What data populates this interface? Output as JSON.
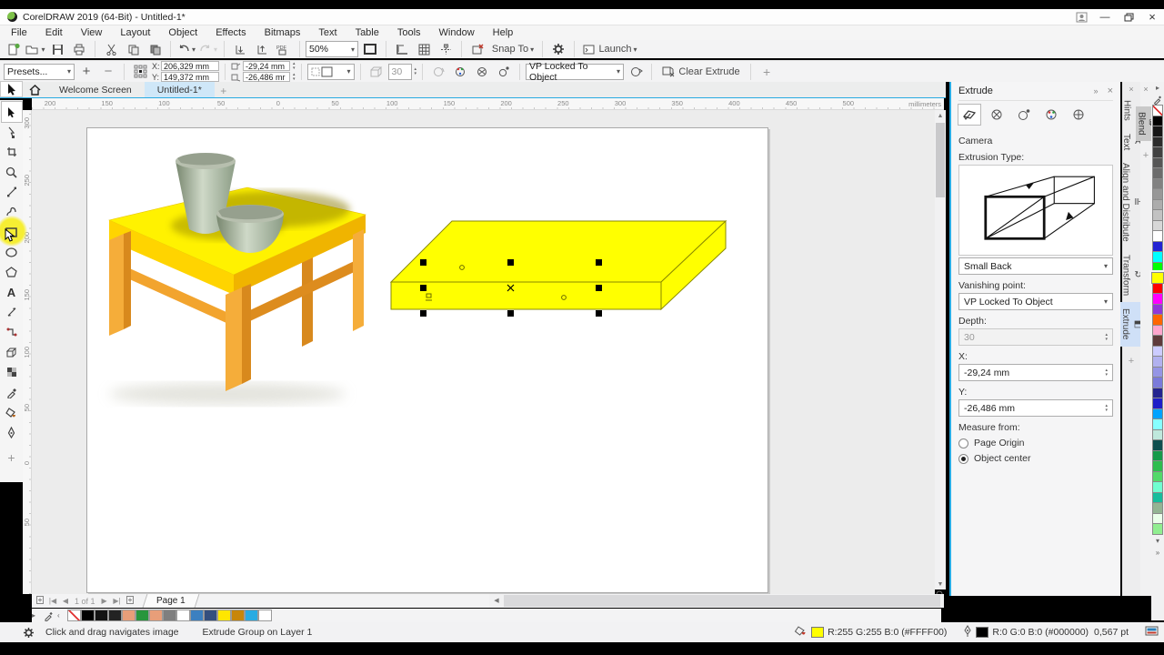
{
  "title_bar": {
    "title": "CorelDRAW 2019 (64-Bit) - Untitled-1*"
  },
  "menu_bar": {
    "items": [
      "File",
      "Edit",
      "View",
      "Layout",
      "Object",
      "Effects",
      "Bitmaps",
      "Text",
      "Table",
      "Tools",
      "Window",
      "Help"
    ]
  },
  "standard_toolbar": {
    "zoom_level": "50%",
    "snap_to_label": "Snap To",
    "launch_label": "Launch"
  },
  "property_bar": {
    "presets_label": "Presets...",
    "x_label": "X:",
    "x_value": "206,329 mm",
    "y_label": "Y:",
    "y_value": "149,372 mm",
    "vp_x_value": "-29,24 mm",
    "vp_y_value": "-26,486 mr",
    "depth_value": "30",
    "vp_mode": "VP Locked To Object",
    "clear_extrude_label": "Clear Extrude"
  },
  "document_tabs": {
    "tabs": [
      {
        "label": "Welcome Screen"
      },
      {
        "label": "Untitled-1*"
      }
    ],
    "active": "Untitled-1*"
  },
  "ruler": {
    "h_ticks": [
      "200",
      "150",
      "100",
      "50",
      "0",
      "50",
      "100",
      "150",
      "200",
      "250",
      "300",
      "350",
      "400",
      "450",
      "500"
    ],
    "v_ticks": [
      "300",
      "250",
      "200",
      "150",
      "100",
      "50",
      "0",
      "50"
    ],
    "units": "millimeters"
  },
  "toolbox": {
    "tools": [
      "pick",
      "shape",
      "crop",
      "zoom",
      "freehand",
      "artistic-media",
      "rectangle",
      "ellipse",
      "polygon",
      "text",
      "parallel-dimension",
      "connector",
      "extrude",
      "transparency",
      "color-eyedropper",
      "interactive-fill",
      "smart-fill"
    ]
  },
  "docker": {
    "title": "Extrude",
    "camera_label": "Camera",
    "extrusion_type_label": "Extrusion Type:",
    "extrusion_preset": "Small Back",
    "vanishing_point_label": "Vanishing point:",
    "vanishing_point_value": "VP Locked To Object",
    "depth_label": "Depth:",
    "depth_value": "30",
    "x_label": "X:",
    "x_value": "-29,24 mm",
    "y_label": "Y:",
    "y_value": "-26,486 mm",
    "measure_from_label": "Measure from:",
    "radio_page_origin": "Page Origin",
    "radio_object_center": "Object center",
    "selected_radio": "Object center"
  },
  "docker_tabs": {
    "items": [
      "Hints",
      "Text",
      "Align and Distribute",
      "Transform",
      "Extrude"
    ],
    "active": "Extrude",
    "blend_label": "Blend"
  },
  "page_controls": {
    "count_text": "1 of 1",
    "page_tab": "Page 1"
  },
  "status_bar": {
    "hint": "Click and drag navigates image",
    "selection_info": "Extrude Group on Layer 1",
    "fill_color_hex": "#FFFF00",
    "fill_info": "R:255 G:255 B:0 (#FFFF00)",
    "outline_color_hex": "#000000",
    "outline_info": "R:0 G:0 B:0 (#000000)",
    "outline_width": "0,567 pt"
  },
  "palette": {
    "colors": [
      "none",
      "#000000",
      "#161616",
      "#2b2b2b",
      "#414141",
      "#565656",
      "#6c6c6c",
      "#818181",
      "#979797",
      "#acacac",
      "#c2c2c2",
      "#d7d7d7",
      "#ffffff",
      "#2323d3",
      "#00ffff",
      "#00ff00",
      "#ffff00",
      "#ff0000",
      "#ff00ff",
      "#9038d8",
      "#ff6600",
      "#ffa6cd",
      "#5e3b3b",
      "#ccccff",
      "#b1b1ef",
      "#9595e5",
      "#7a7ada",
      "#24248f",
      "#1e1ec8",
      "#00a2ff",
      "#86ffff",
      "#bfe8dc",
      "#0e4f4f",
      "#169a4a",
      "#2ebd4e",
      "#52d969",
      "#6fffd0",
      "#16bd9c",
      "#93b493",
      "#eaffea",
      "#90ee90"
    ],
    "selected_index": 16
  },
  "document_palette": {
    "colors": [
      "none",
      "#000000",
      "#141414",
      "#232323",
      "#e89e79",
      "#28963d",
      "#e89e79",
      "#7f7f7f",
      "#ffffff",
      "#3c80c0",
      "#344f7e",
      "#ffe600",
      "#c8860a",
      "#29abe2",
      "#ffffff"
    ]
  }
}
